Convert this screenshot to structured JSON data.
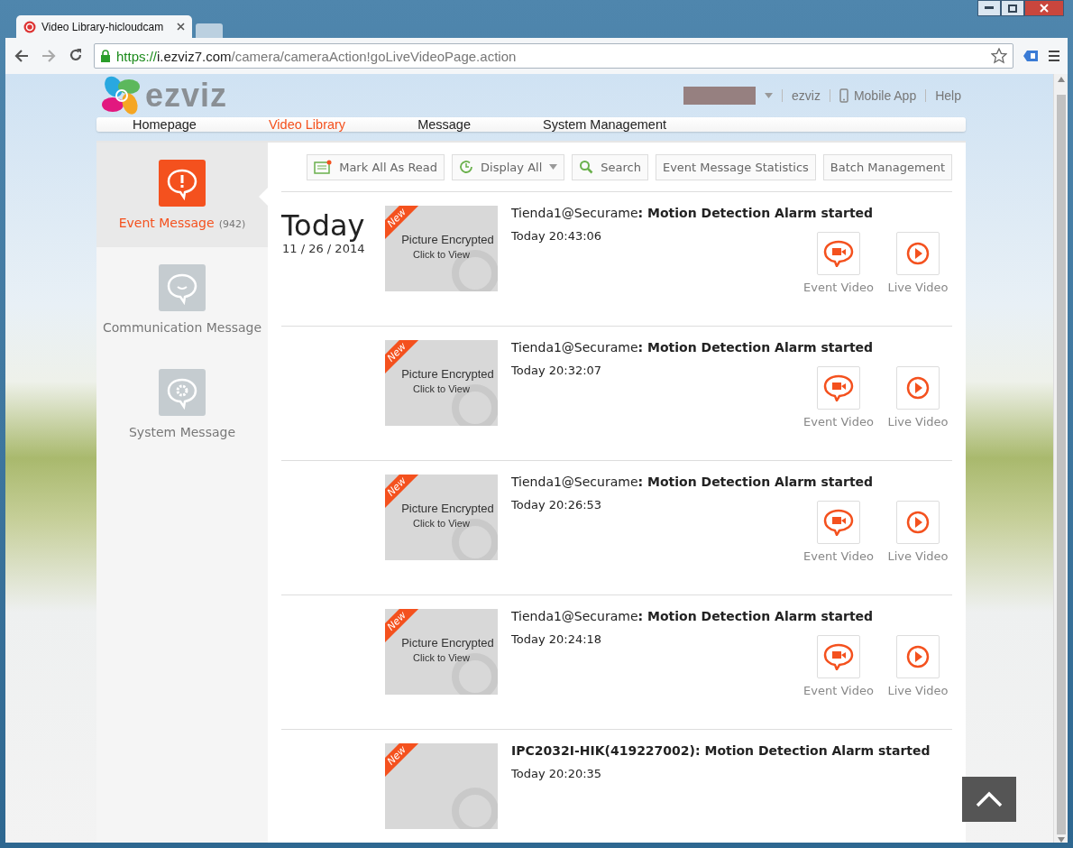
{
  "browser": {
    "tab_title": "Video Library-hicloudcam",
    "url_scheme": "https://",
    "url_host": "i.ezviz7.com",
    "url_path": "/camera/cameraAction!goLiveVideoPage.action"
  },
  "header": {
    "logo_text": "ezviz",
    "links": [
      {
        "kind": "user",
        "label": "ezviz"
      },
      {
        "kind": "app",
        "label": "Mobile App"
      },
      {
        "kind": "plain",
        "label": "Help"
      }
    ]
  },
  "nav": [
    {
      "label": "Homepage",
      "selected": false
    },
    {
      "label": "Video Library",
      "selected": true
    },
    {
      "label": "Message",
      "selected": false
    },
    {
      "label": "System Management",
      "selected": false
    }
  ],
  "sidebar": [
    {
      "kind": "event",
      "label": "Event Message",
      "count": "(942)",
      "selected": true
    },
    {
      "kind": "communication",
      "label": "Communication Message",
      "selected": false
    },
    {
      "kind": "system",
      "label": "System Message",
      "selected": false
    }
  ],
  "toolbar": [
    {
      "kind": "read",
      "label": "Mark All As Read"
    },
    {
      "kind": "display",
      "label": "Display All"
    },
    {
      "kind": "search",
      "label": "Search"
    },
    {
      "kind": "plain",
      "label": "Event Message Statistics"
    },
    {
      "kind": "plain",
      "label": "Batch Management"
    }
  ],
  "date_group": {
    "day": "Today",
    "date": "11 / 26 / 2014"
  },
  "events": [
    {
      "badge": "New",
      "thumb_title": "Picture Encrypted",
      "thumb_hint": "Click to View",
      "device": "Tienda1@Securame",
      "device_bold": false,
      "event": ": Motion Detection Alarm started",
      "time": "Today 20:43:06",
      "buttons": [
        "Event Video",
        "Live Video"
      ]
    },
    {
      "badge": "New",
      "thumb_title": "Picture Encrypted",
      "thumb_hint": "Click to View",
      "device": "Tienda1@Securame",
      "device_bold": false,
      "event": ": Motion Detection Alarm started",
      "time": "Today 20:32:07",
      "buttons": [
        "Event Video",
        "Live Video"
      ]
    },
    {
      "badge": "New",
      "thumb_title": "Picture Encrypted",
      "thumb_hint": "Click to View",
      "device": "Tienda1@Securame",
      "device_bold": false,
      "event": ": Motion Detection Alarm started",
      "time": "Today 20:26:53",
      "buttons": [
        "Event Video",
        "Live Video"
      ]
    },
    {
      "badge": "New",
      "thumb_title": "Picture Encrypted",
      "thumb_hint": "Click to View",
      "device": "Tienda1@Securame",
      "device_bold": false,
      "event": ": Motion Detection Alarm started",
      "time": "Today 20:24:18",
      "buttons": [
        "Event Video",
        "Live Video"
      ]
    },
    {
      "badge": "New",
      "device": "IPC2032I-HIK(419227002)",
      "device_bold": true,
      "event": ": Motion Detection Alarm started",
      "time": "Today 20:20:35"
    }
  ]
}
